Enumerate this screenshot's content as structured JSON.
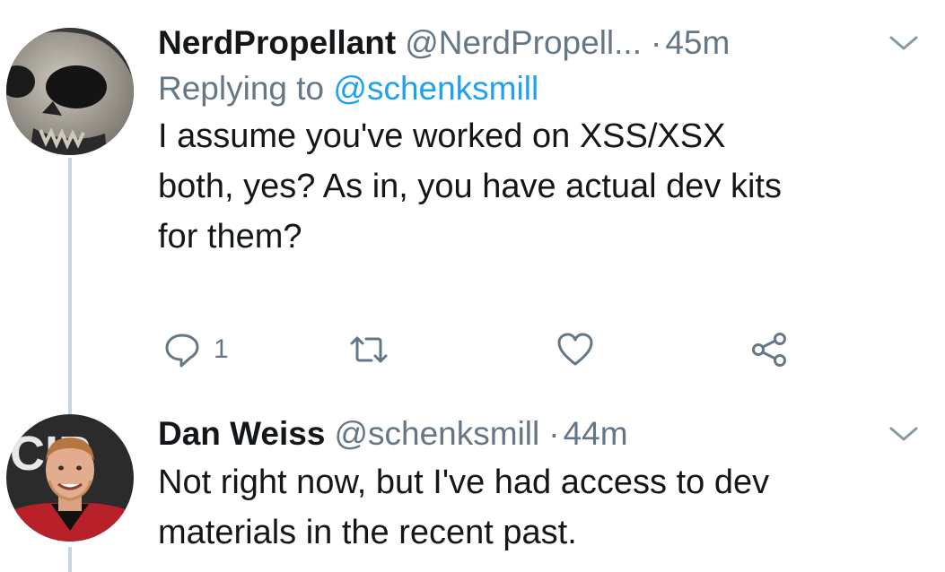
{
  "tweets": [
    {
      "display_name": "NerdPropellant",
      "handle": "@NerdPropell...",
      "separator": "·",
      "time": "45m",
      "replying_prefix": "Replying to",
      "replying_to": "@schenksmill",
      "text_lines": [
        "I assume you've worked on XSS/XSX",
        "both, yes? As in, you have actual dev kits",
        "for them?"
      ],
      "reply_count": "1",
      "avatar_icon": "skull-avatar"
    },
    {
      "display_name": "Dan Weiss",
      "handle": "@schenksmill",
      "separator": "·",
      "time": "44m",
      "text_lines": [
        "Not right now, but I've had access to dev",
        "materials in the recent past."
      ],
      "avatar_letters": "CIP",
      "avatar_icon": "person-avatar"
    }
  ],
  "icons": {
    "reply": "reply-icon",
    "retweet": "retweet-icon",
    "like": "heart-icon",
    "share": "share-icon",
    "menu": "chevron-down-icon"
  },
  "colors": {
    "text": "#14171a",
    "secondary": "#657786",
    "link": "#1da1f2",
    "thread_line": "#ccd6dd"
  }
}
